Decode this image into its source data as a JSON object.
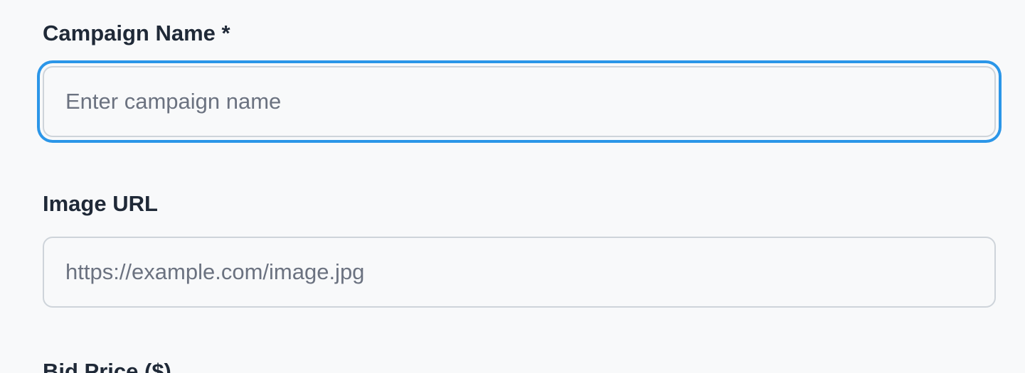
{
  "form": {
    "campaign_name": {
      "label": "Campaign Name *",
      "placeholder": "Enter campaign name",
      "value": ""
    },
    "image_url": {
      "label": "Image URL",
      "placeholder": "https://example.com/image.jpg",
      "value": ""
    },
    "bid_price": {
      "label": "Bid Price ($)"
    }
  },
  "colors": {
    "background": "#f8f9fa",
    "focus_ring": "#2b96e8",
    "input_border": "#ced4da",
    "label_text": "#1f2937",
    "placeholder_text": "#6b7280"
  }
}
